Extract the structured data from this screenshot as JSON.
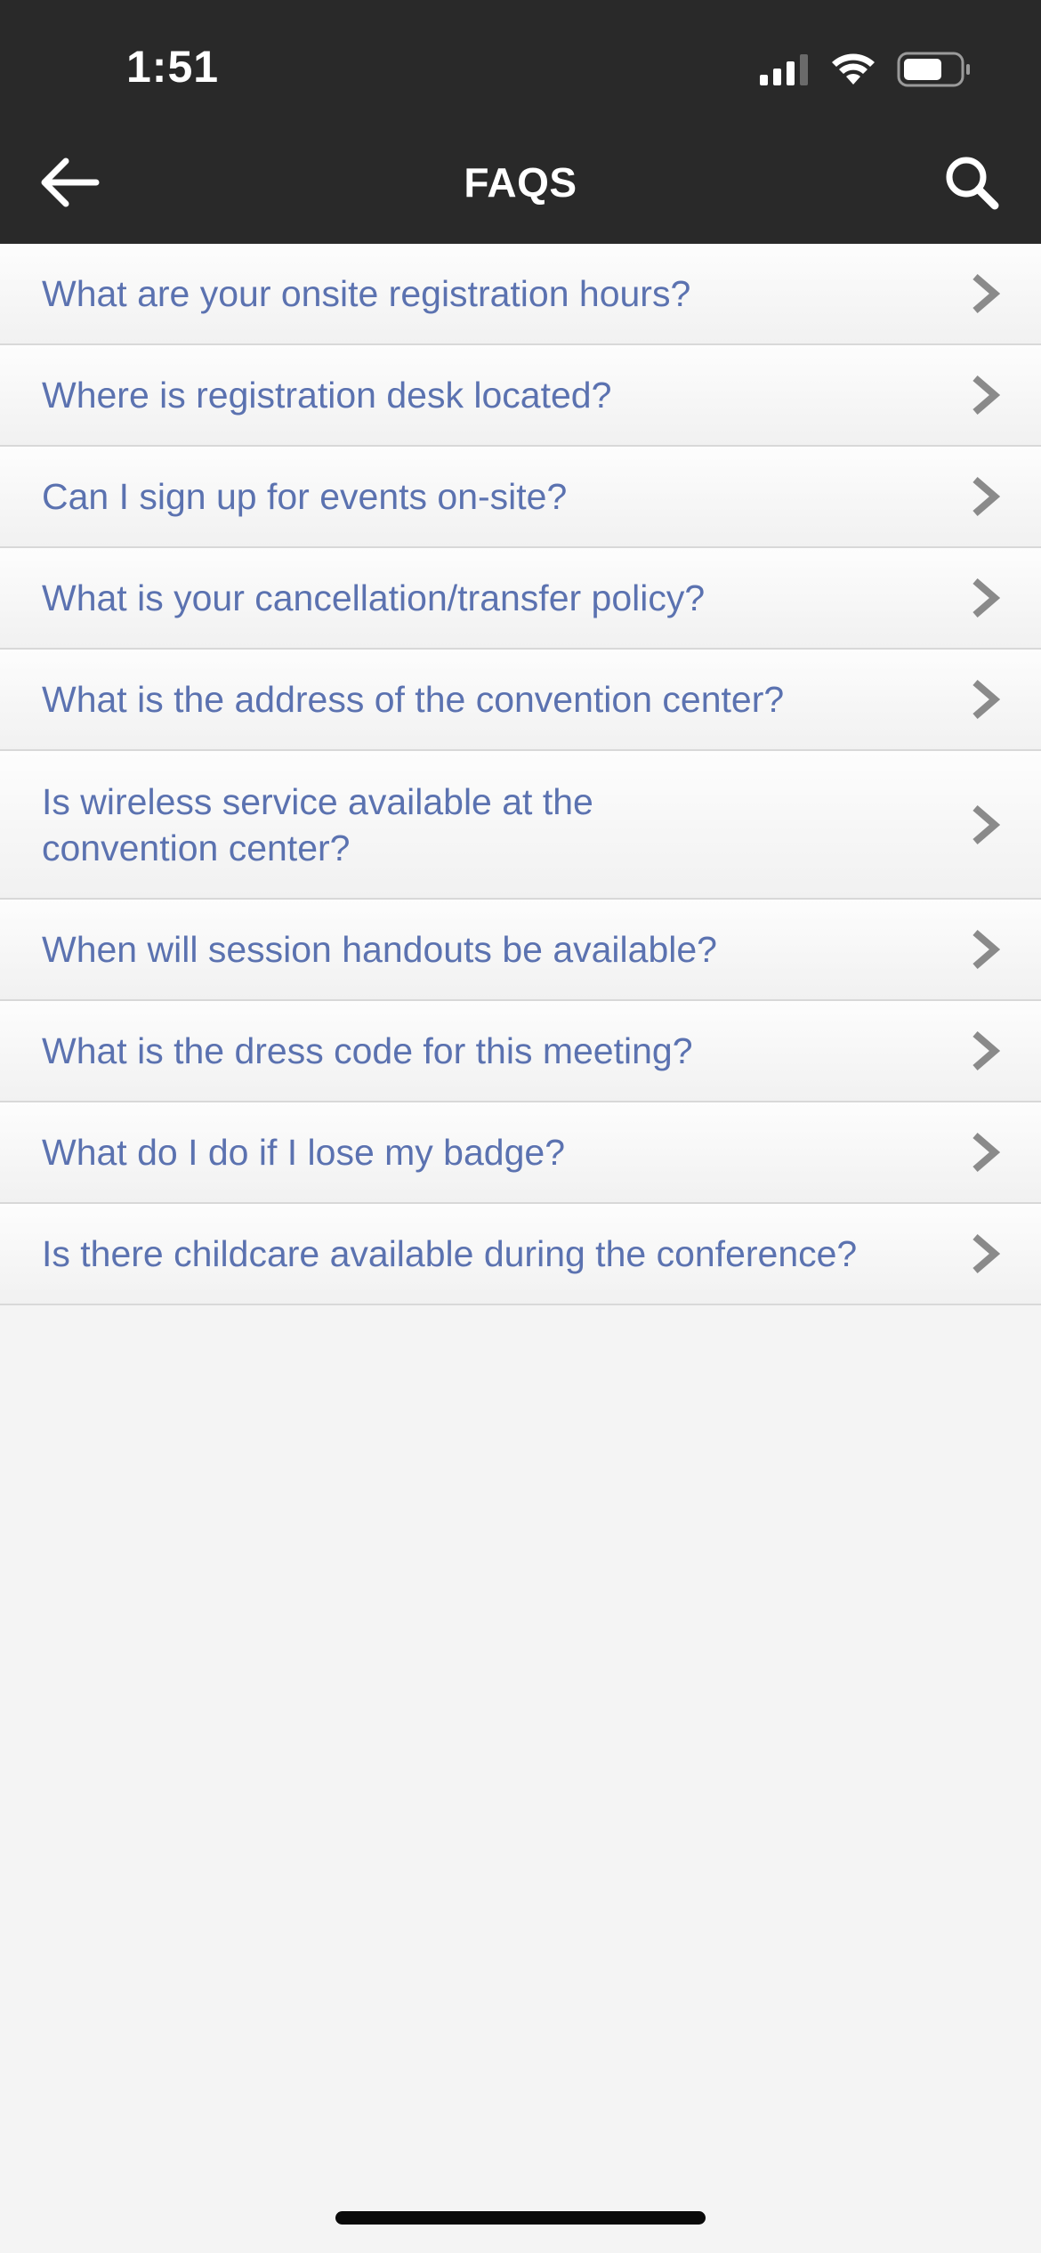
{
  "status_bar": {
    "time": "1:51"
  },
  "nav": {
    "title": "FAQS",
    "back_icon": "arrow-left-icon",
    "search_icon": "search-icon"
  },
  "colors": {
    "header_bg": "#292929",
    "link_text": "#5b72b0",
    "chevron": "#8a8a8a",
    "page_bg": "#f4f4f4"
  },
  "faqs": [
    {
      "label": "What are your onsite registration hours?"
    },
    {
      "label": "Where is registration desk located?"
    },
    {
      "label": "Can I sign up for events on-site?"
    },
    {
      "label": "What is your cancellation/transfer policy?"
    },
    {
      "label": "What is the address of the convention center?"
    },
    {
      "label": "Is wireless service available at the convention center?"
    },
    {
      "label": "When will session handouts be available?"
    },
    {
      "label": "What is the dress code for this meeting?"
    },
    {
      "label": "What do I do if I lose my badge?"
    },
    {
      "label": "Is there childcare available during the conference?"
    }
  ]
}
